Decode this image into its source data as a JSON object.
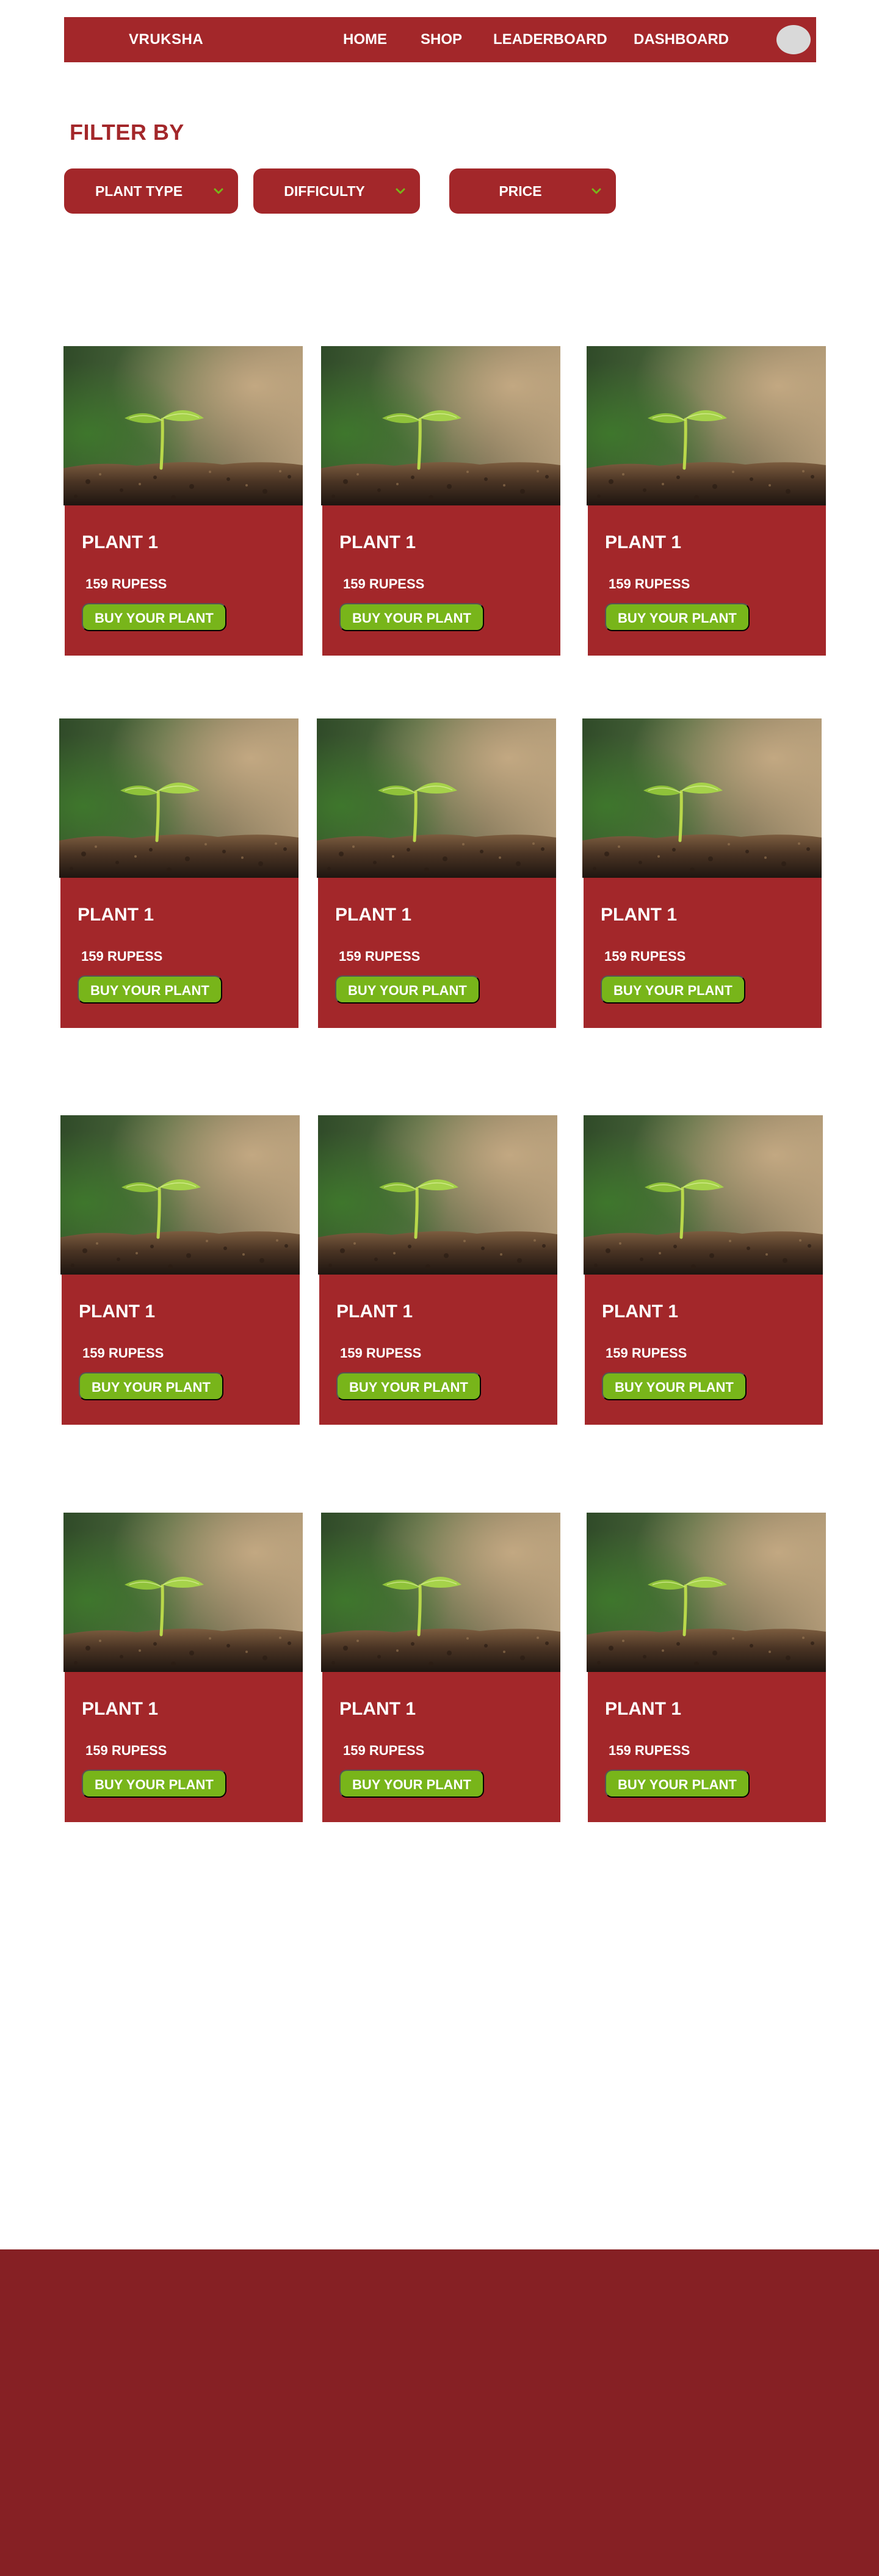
{
  "nav": {
    "brand": "VRUKSHA",
    "links": [
      "HOME",
      "SHOP",
      "LEADERBOARD",
      "DASHBOARD"
    ]
  },
  "filter": {
    "title": "FILTER BY",
    "options": [
      "PLANT TYPE",
      "DIFFICULTY",
      "PRICE"
    ]
  },
  "products": [
    {
      "name": "PLANT 1",
      "price": "159 RUPESS",
      "cta": "BUY YOUR PLANT"
    },
    {
      "name": "PLANT 1",
      "price": "159 RUPESS",
      "cta": "BUY YOUR PLANT"
    },
    {
      "name": "PLANT 1",
      "price": "159 RUPESS",
      "cta": "BUY YOUR PLANT"
    },
    {
      "name": "PLANT 1",
      "price": "159 RUPESS",
      "cta": "BUY YOUR PLANT"
    },
    {
      "name": "PLANT 1",
      "price": "159 RUPESS",
      "cta": "BUY YOUR PLANT"
    },
    {
      "name": "PLANT 1",
      "price": "159 RUPESS",
      "cta": "BUY YOUR PLANT"
    },
    {
      "name": "PLANT 1",
      "price": "159 RUPESS",
      "cta": "BUY YOUR PLANT"
    },
    {
      "name": "PLANT 1",
      "price": "159 RUPESS",
      "cta": "BUY YOUR PLANT"
    },
    {
      "name": "PLANT 1",
      "price": "159 RUPESS",
      "cta": "BUY YOUR PLANT"
    },
    {
      "name": "PLANT 1",
      "price": "159 RUPESS",
      "cta": "BUY YOUR PLANT"
    },
    {
      "name": "PLANT 1",
      "price": "159 RUPESS",
      "cta": "BUY YOUR PLANT"
    },
    {
      "name": "PLANT 1",
      "price": "159 RUPESS",
      "cta": "BUY YOUR PLANT"
    }
  ],
  "colors": {
    "primary": "#a3272a",
    "accent": "#78b51a",
    "footer": "#862024"
  },
  "icons": {
    "avatar": "user-avatar-icon",
    "dropdown": "chevron-down-icon",
    "product_image": "seedling-photo"
  }
}
